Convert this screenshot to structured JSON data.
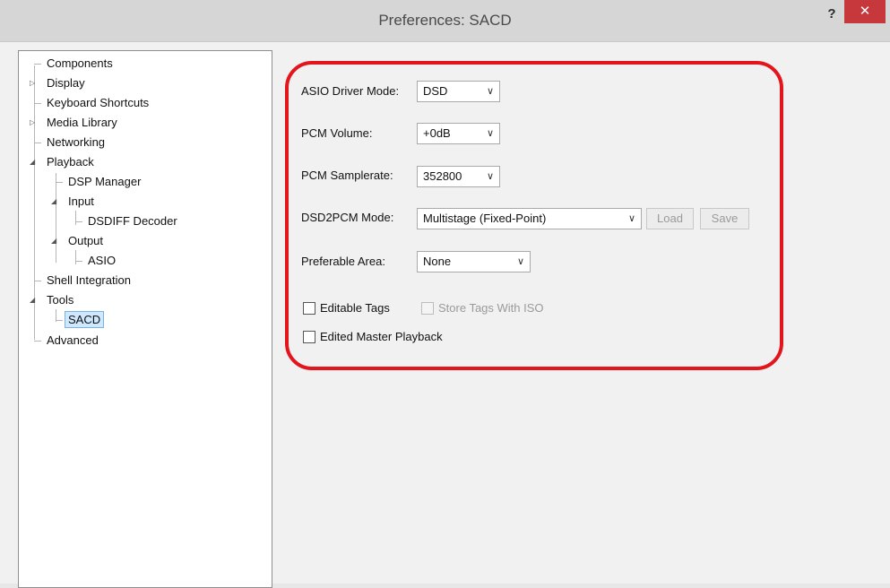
{
  "window": {
    "title": "Preferences: SACD",
    "help_label": "?",
    "close_label": "✕"
  },
  "tree": {
    "items": [
      {
        "label": "Components"
      },
      {
        "label": "Display"
      },
      {
        "label": "Keyboard Shortcuts"
      },
      {
        "label": "Media Library"
      },
      {
        "label": "Networking"
      },
      {
        "label": "Playback"
      },
      {
        "label": "DSP Manager"
      },
      {
        "label": "Input"
      },
      {
        "label": "DSDIFF Decoder"
      },
      {
        "label": "Output"
      },
      {
        "label": "ASIO"
      },
      {
        "label": "Shell Integration"
      },
      {
        "label": "Tools"
      },
      {
        "label": "SACD"
      },
      {
        "label": "Advanced"
      }
    ],
    "collapsed_glyph": "▷",
    "expanded_glyph": "◢"
  },
  "settings": {
    "asio_driver_mode": {
      "label": "ASIO Driver Mode:",
      "value": "DSD"
    },
    "pcm_volume": {
      "label": "PCM Volume:",
      "value": "+0dB"
    },
    "pcm_samplerate": {
      "label": "PCM Samplerate:",
      "value": "352800"
    },
    "dsd2pcm_mode": {
      "label": "DSD2PCM Mode:",
      "value": "Multistage (Fixed-Point)",
      "load_label": "Load",
      "save_label": "Save"
    },
    "preferable_area": {
      "label": "Preferable Area:",
      "value": "None"
    },
    "editable_tags": {
      "label": "Editable Tags"
    },
    "store_tags_with_iso": {
      "label": "Store Tags With ISO"
    },
    "edited_master_playback": {
      "label": "Edited Master Playback"
    },
    "chevron_glyph": "∨"
  },
  "colors": {
    "highlight_border": "#e4141c",
    "close_button": "#c7383d",
    "selection": "#cde8ff"
  }
}
